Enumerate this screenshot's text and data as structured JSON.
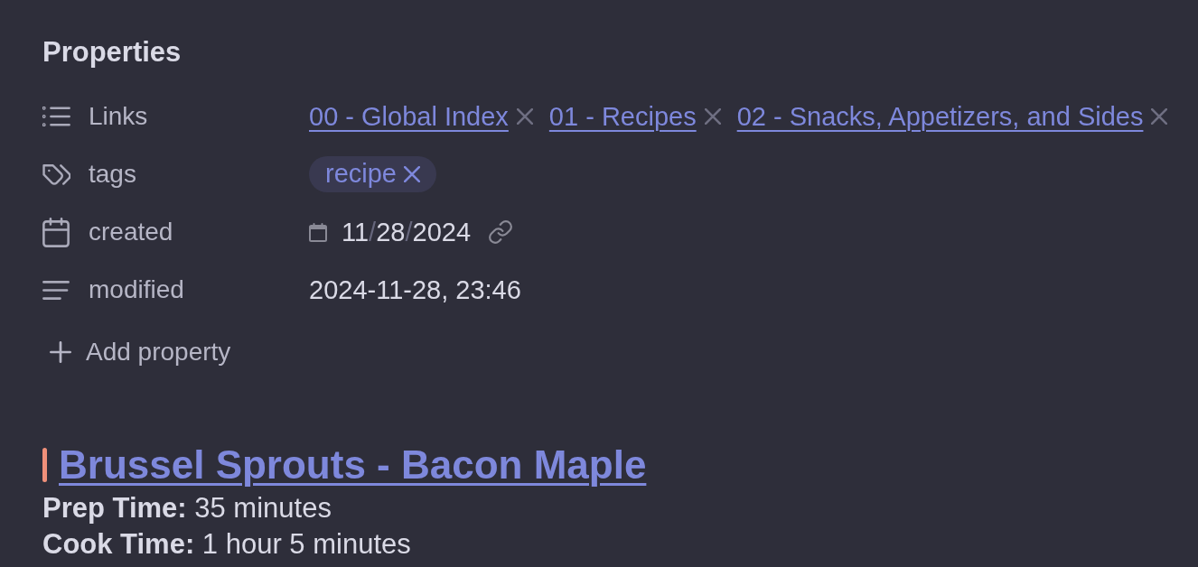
{
  "properties": {
    "title": "Properties",
    "items": [
      {
        "kind": "links",
        "name": "Links",
        "values": [
          "00 - Global Index",
          "01 - Recipes",
          "02 - Snacks, Appetizers, and Sides"
        ]
      },
      {
        "kind": "tags",
        "name": "tags",
        "values": [
          "recipe"
        ]
      },
      {
        "kind": "date",
        "name": "created",
        "parts": [
          {
            "kind": "number",
            "text": "11"
          },
          {
            "kind": "separator",
            "text": "/"
          },
          {
            "kind": "number",
            "text": "28"
          },
          {
            "kind": "separator",
            "text": "/"
          },
          {
            "kind": "number",
            "text": "2024"
          }
        ]
      },
      {
        "kind": "datetime",
        "name": "modified",
        "value": "2024-11-28, 23:46"
      }
    ],
    "add_button": "Add property"
  },
  "note": {
    "heading": "Brussel Sprouts - Bacon Maple",
    "lines": [
      "**Prep Time:** 35 minutes",
      "**Cook Time:** 1 hour 5 minutes"
    ]
  }
}
